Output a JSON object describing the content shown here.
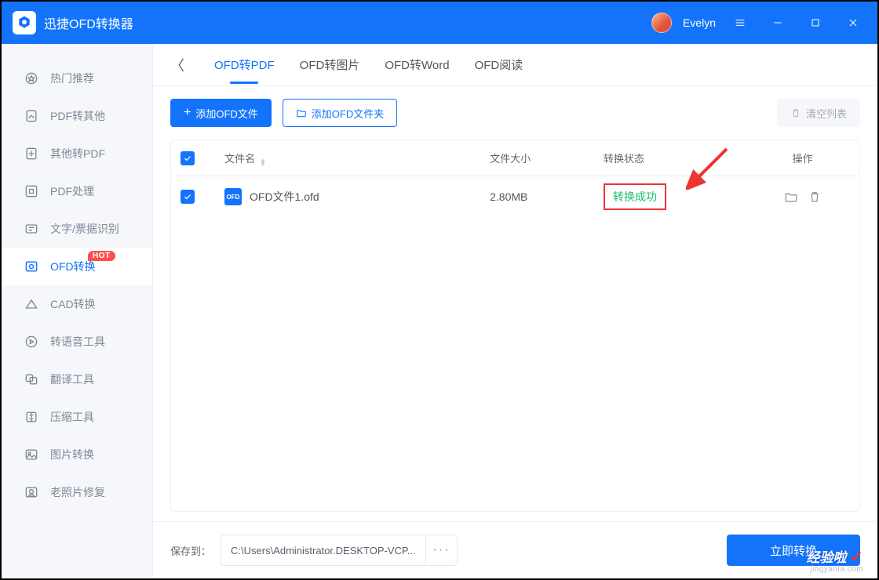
{
  "header": {
    "app_title": "迅捷OFD转换器",
    "user_name": "Evelyn"
  },
  "sidebar": {
    "items": [
      {
        "label": "热门推荐",
        "icon": "star-badge-icon"
      },
      {
        "label": "PDF转其他",
        "icon": "pdf-out-icon"
      },
      {
        "label": "其他转PDF",
        "icon": "pdf-in-icon"
      },
      {
        "label": "PDF处理",
        "icon": "pdf-tools-icon"
      },
      {
        "label": "文字/票据识别",
        "icon": "ocr-icon"
      },
      {
        "label": "OFD转换",
        "icon": "ofd-icon",
        "active": true,
        "hot": "HOT"
      },
      {
        "label": "CAD转换",
        "icon": "cad-icon"
      },
      {
        "label": "转语音工具",
        "icon": "audio-icon"
      },
      {
        "label": "翻译工具",
        "icon": "translate-icon"
      },
      {
        "label": "压缩工具",
        "icon": "compress-icon"
      },
      {
        "label": "图片转换",
        "icon": "image-icon"
      },
      {
        "label": "老照片修复",
        "icon": "photo-restore-icon"
      }
    ]
  },
  "tabs": [
    {
      "label": "OFD转PDF",
      "active": true
    },
    {
      "label": "OFD转图片"
    },
    {
      "label": "OFD转Word"
    },
    {
      "label": "OFD阅读"
    }
  ],
  "toolbar": {
    "add_file": "添加OFD文件",
    "add_folder": "添加OFD文件夹",
    "clear_list": "清空列表"
  },
  "table": {
    "headers": {
      "name": "文件名",
      "size": "文件大小",
      "status": "转换状态",
      "ops": "操作"
    },
    "rows": [
      {
        "name": "OFD文件1.ofd",
        "size": "2.80MB",
        "status": "转换成功"
      }
    ]
  },
  "footer": {
    "save_label": "保存到：",
    "path": "C:\\Users\\Administrator.DESKTOP-VCP...",
    "more": "···",
    "convert": "立即转换"
  },
  "watermark": {
    "top": "经验啦",
    "check": "✓",
    "bottom": "jingyanla.com"
  }
}
